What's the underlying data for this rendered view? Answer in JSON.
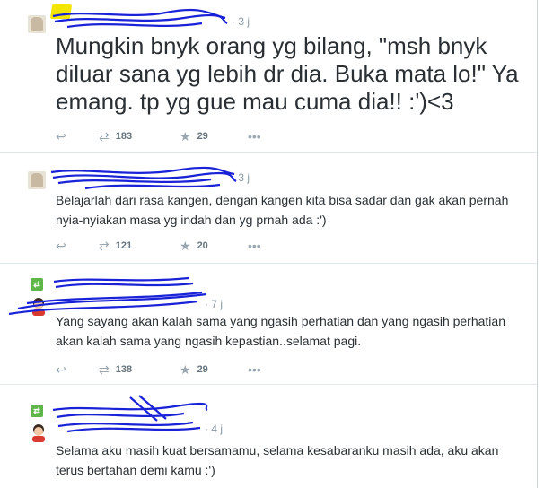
{
  "tweets": [
    {
      "time": "3 j",
      "text": "Mungkin bnyk orang yg bilang, \"msh bnyk diluar sana yg lebih dr dia. Buka mata lo!\" Ya emang. tp yg gue mau cuma dia!! :')<3",
      "retweets": "183",
      "favorites": "29"
    },
    {
      "time": "3 j",
      "text": "Belajarlah dari rasa kangen, dengan kangen kita bisa sadar dan gak akan pernah nyia-nyiakan masa yg indah dan yg prnah ada :')",
      "retweets": "121",
      "favorites": "20"
    },
    {
      "time": "7 j",
      "text": "Yang sayang akan kalah sama yang ngasih perhatian dan yang ngasih perhatian akan kalah sama yang ngasih kepastian..selamat pagi.",
      "retweets": "138",
      "favorites": "29"
    },
    {
      "time": "4 j",
      "text": "Selama aku masih kuat bersamamu, selama kesabaranku masih ada, aku akan terus bertahan demi kamu :')"
    }
  ],
  "icons": {
    "reply": "reply-icon",
    "retweet": "retweet-icon",
    "favorite": "star-icon",
    "more": "more-icon"
  },
  "colors": {
    "scribble": "#1a22d8",
    "retweet_badge": "#5fb649",
    "meta_text": "#8899a6"
  }
}
